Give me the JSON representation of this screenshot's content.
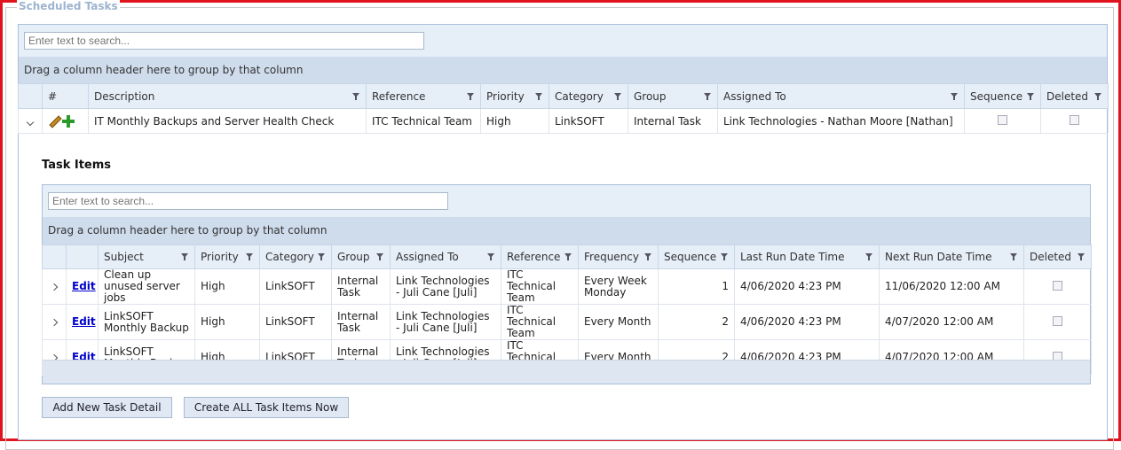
{
  "panel": {
    "legend": "Scheduled Tasks"
  },
  "outer_grid": {
    "search_placeholder": "Enter text to search...",
    "group_hint": "Drag a column header here to group by that column",
    "columns": [
      "#",
      "Description",
      "Reference",
      "Priority",
      "Category",
      "Group",
      "Assigned To",
      "Sequence",
      "Deleted"
    ],
    "row": {
      "description": "IT Monthly Backups and Server Health Check",
      "reference": "ITC Technical Team",
      "priority": "High",
      "category": "LinkSOFT",
      "group": "Internal Task",
      "assigned_to": "Link Technologies - Nathan Moore [Nathan]",
      "icons": [
        "chevron-down-icon",
        "pencil-icon",
        "plus-icon"
      ]
    }
  },
  "task_items": {
    "title": "Task Items",
    "search_placeholder": "Enter text to search...",
    "group_hint": "Drag a column header here to group by that column",
    "columns": [
      "Subject",
      "Priority",
      "Category",
      "Group",
      "Assigned To",
      "Reference",
      "Frequency",
      "Sequence",
      "Last Run Date Time",
      "Next Run Date Time",
      "Deleted"
    ],
    "edit_label": "Edit",
    "rows": [
      {
        "subject": "Clean up unused server jobs",
        "priority": "High",
        "category": "LinkSOFT",
        "group": "Internal Task",
        "assigned_to": "Link Technologies - Juli Cane [Juli]",
        "reference": "ITC Technical Team",
        "frequency": "Every Week Monday",
        "sequence": "1",
        "last_run": "4/06/2020 4:23 PM",
        "next_run": "11/06/2020 12:00 AM"
      },
      {
        "subject": "LinkSOFT Monthly Backup",
        "priority": "High",
        "category": "LinkSOFT",
        "group": "Internal Task",
        "assigned_to": "Link Technologies - Juli Cane [Juli]",
        "reference": "ITC Technical Team",
        "frequency": "Every Month",
        "sequence": "2",
        "last_run": "4/06/2020 4:23 PM",
        "next_run": "4/07/2020 12:00 AM"
      },
      {
        "subject": "LinkSOFT Monthly Backup",
        "priority": "High",
        "category": "LinkSOFT",
        "group": "Internal Task",
        "assigned_to": "Link Technologies - Juli Cane [Juli]",
        "reference": "ITC Technical Team",
        "frequency": "Every Month",
        "sequence": "2",
        "last_run": "4/06/2020 4:23 PM",
        "next_run": "4/07/2020 12:00 AM"
      }
    ]
  },
  "buttons": {
    "add_new": "Add New Task Detail",
    "create_all": "Create ALL Task Items Now"
  },
  "colors": {
    "frame": "#e0141e",
    "header_bg": "#e6eef8",
    "group_band": "#cfdcec",
    "link": "#0000cc"
  }
}
